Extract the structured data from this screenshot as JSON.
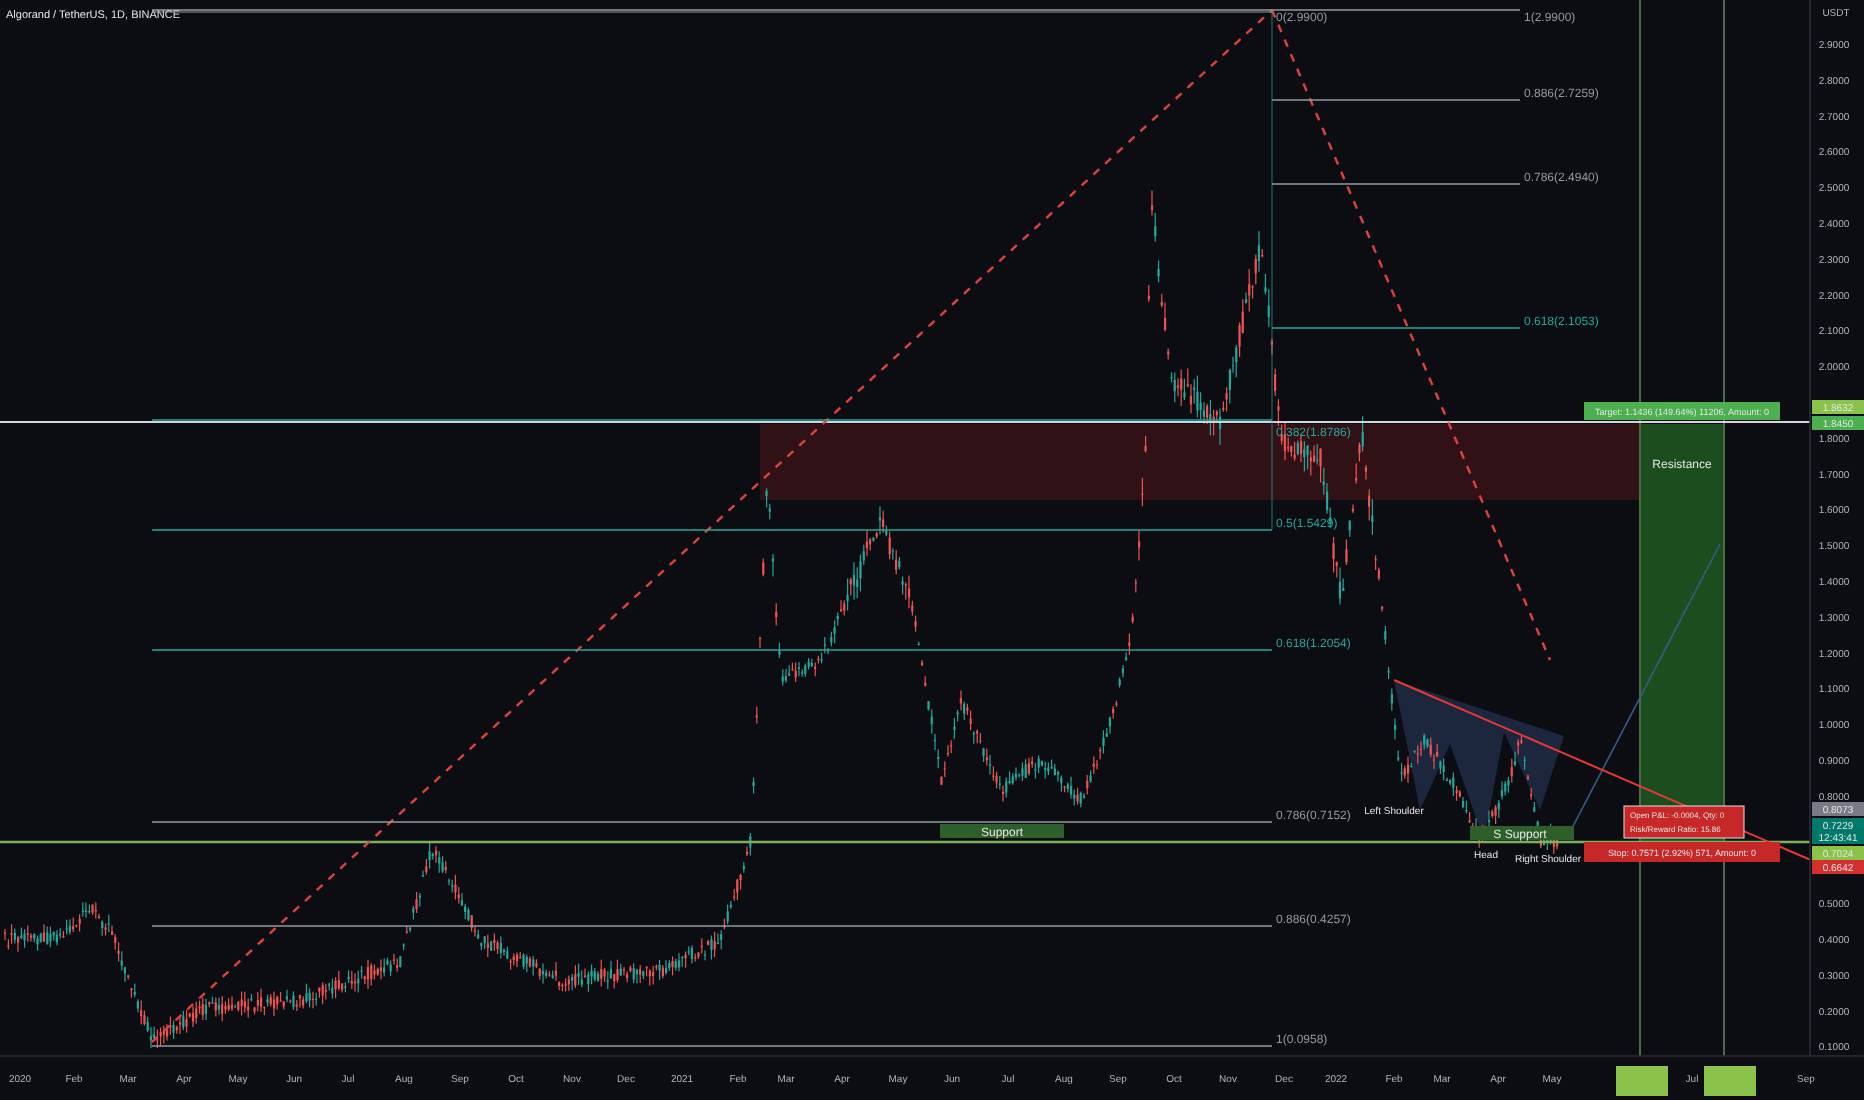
{
  "chart": {
    "title": "Algorand / TetherUS, 1D, BINANCE",
    "currency": "USDT"
  },
  "price_axis": [
    "2.9000",
    "2.8000",
    "2.7000",
    "2.6000",
    "2.5000",
    "2.4000",
    "2.3000",
    "2.2000",
    "2.1000",
    "2.0000",
    "1.8000",
    "1.7000",
    "1.6000",
    "1.5000",
    "1.4000",
    "1.3000",
    "1.2000",
    "1.1000",
    "1.0000",
    "0.9000",
    "0.8000",
    "0.5000",
    "0.4000",
    "0.3000",
    "0.2000",
    "0.1000"
  ],
  "time_axis": [
    "2020",
    "Feb",
    "Mar",
    "Apr",
    "May",
    "Jun",
    "Jul",
    "Aug",
    "Sep",
    "Oct",
    "Nov",
    "Dec",
    "2021",
    "Feb",
    "Mar",
    "Apr",
    "May",
    "Jun",
    "Jul",
    "Aug",
    "Sep",
    "Oct",
    "Nov",
    "Dec",
    "2022",
    "Feb",
    "Mar",
    "Apr",
    "May",
    "Jul",
    "Sep"
  ],
  "fib_lower": [
    {
      "label": "0(2.9900)",
      "color": "#9598a1"
    },
    {
      "label": "0.382(1.8786)",
      "color": "#26a69a"
    },
    {
      "label": "0.5(1.5429)",
      "color": "#26a69a"
    },
    {
      "label": "0.618(1.2054)",
      "color": "#26a69a"
    },
    {
      "label": "0.786(0.7152)",
      "color": "#9598a1"
    },
    {
      "label": "0.886(0.4257)",
      "color": "#9598a1"
    },
    {
      "label": "1(0.0958)",
      "color": "#9598a1"
    }
  ],
  "fib_upper": [
    {
      "label": "1(2.9900)",
      "color": "#9598a1"
    },
    {
      "label": "0.886(2.7259)",
      "color": "#9598a1"
    },
    {
      "label": "0.786(2.4940)",
      "color": "#9598a1"
    },
    {
      "label": "0.618(2.1053)",
      "color": "#26a69a"
    }
  ],
  "annotations": {
    "support_left": "Support",
    "support_right": "S Support",
    "left_shoulder": "Left Shoulder",
    "head": "Head",
    "right_shoulder": "Right Shoulder",
    "resistance": "Resistance"
  },
  "position": {
    "target": "Target: 1.1436 (149.64%) 11206, Amount: 0",
    "pnl": "Open P&L: -0.0004, Qty: 0",
    "ratio": "Risk/Reward Ratio: 15.86",
    "stop": "Stop: 0.7571 (2.92%) 571, Amount: 0"
  },
  "price_tags": [
    {
      "label": "1.8632",
      "color": "#8bc34a"
    },
    {
      "label": "1.8450",
      "color": "#4caf50"
    },
    {
      "label": "0.8073",
      "color": "#787b86"
    },
    {
      "label": "0.7229",
      "color": "#00796b"
    },
    {
      "label": "12:43:41",
      "color": "#00796b"
    },
    {
      "label": "0.7024",
      "color": "#8bc34a"
    },
    {
      "label": "0.6642",
      "color": "#d32f2f"
    }
  ]
}
